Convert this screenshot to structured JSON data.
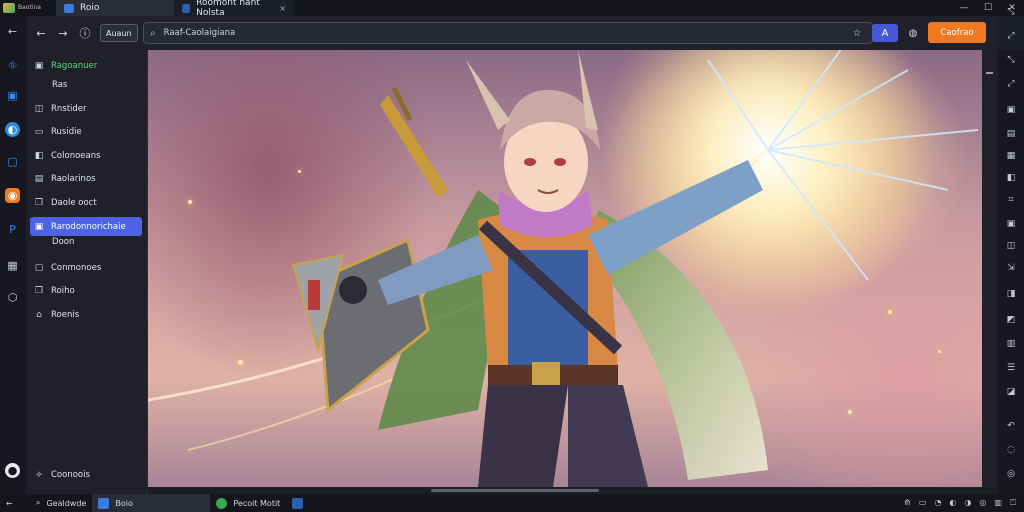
{
  "titlebar": {
    "app_logo_text": "Baotina",
    "tabs": [
      {
        "label": "Roio",
        "active": true
      },
      {
        "label": "Roomont hant Nolsta",
        "active": false
      }
    ],
    "tab_close": "×",
    "window_controls": {
      "minimize": "—",
      "maximize": "☐",
      "close": "✕"
    }
  },
  "toolbar": {
    "back": "←",
    "forward": "→",
    "info": "ⓘ",
    "pill_label": "Auaun",
    "search_icon": "⌕",
    "address_text": "Raaf-Caolaigiana",
    "orange_button": "Caofrao"
  },
  "sidebar": {
    "items": [
      {
        "label": "Ragoanuer",
        "icon": "▣",
        "style": "green"
      },
      {
        "label": "Ras",
        "icon": "",
        "style": "plain"
      },
      {
        "label": "Rnstider",
        "icon": "◫",
        "style": "plain"
      },
      {
        "label": "Rusidie",
        "icon": "▭",
        "style": "plain"
      },
      {
        "label": "Colonoeans",
        "icon": "◧",
        "style": "plain"
      },
      {
        "label": "Raolarinos",
        "icon": "▤",
        "style": "plain"
      },
      {
        "label": "Daole ooct",
        "icon": "❐",
        "style": "plain"
      },
      {
        "label": "Rarodonnorichaie",
        "icon": "▣",
        "style": "active"
      },
      {
        "label": "Doon",
        "icon": "",
        "style": "plain"
      },
      {
        "label": "Conmonoes",
        "icon": "▢",
        "style": "plain"
      },
      {
        "label": "Roiho",
        "icon": "❐",
        "style": "plain"
      },
      {
        "label": "Roenis",
        "icon": "⌂",
        "style": "plain"
      }
    ],
    "bottom_item": {
      "label": "Coonoois",
      "icon": "⟡"
    }
  },
  "taskbar": {
    "items": [
      {
        "label": "Gealdwde",
        "icon_color": "#9aa0ad"
      },
      {
        "label": "Boio",
        "icon_color": "#3b7ce0"
      },
      {
        "label": "Pecoit Motit",
        "icon_color": "#3aa84f"
      }
    ],
    "tray": [
      "⟰",
      "▭",
      "◔",
      "◐",
      "◑",
      "◎",
      "▥",
      "⏍"
    ]
  },
  "colors": {
    "accent": "#4c63e6",
    "orange": "#f07a24",
    "green": "#59d98c"
  }
}
